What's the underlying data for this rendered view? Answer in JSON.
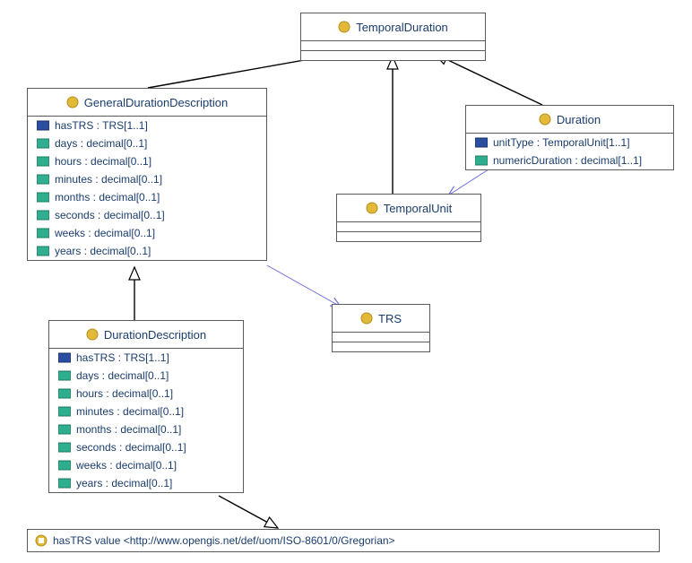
{
  "classes": {
    "temporalDuration": {
      "name": "TemporalDuration"
    },
    "generalDurationDescription": {
      "name": "GeneralDurationDescription",
      "attrs": {
        "hasTRS": {
          "label": "hasTRS : TRS[1..1]",
          "kind": "ref"
        },
        "days": {
          "label": "days : decimal[0..1]",
          "kind": "data"
        },
        "hours": {
          "label": "hours : decimal[0..1]",
          "kind": "data"
        },
        "minutes": {
          "label": "minutes : decimal[0..1]",
          "kind": "data"
        },
        "months": {
          "label": "months : decimal[0..1]",
          "kind": "data"
        },
        "seconds": {
          "label": "seconds : decimal[0..1]",
          "kind": "data"
        },
        "weeks": {
          "label": "weeks : decimal[0..1]",
          "kind": "data"
        },
        "years": {
          "label": "years : decimal[0..1]",
          "kind": "data"
        }
      }
    },
    "durationDescription": {
      "name": "DurationDescription",
      "attrs": {
        "hasTRS": {
          "label": "hasTRS : TRS[1..1]",
          "kind": "ref"
        },
        "days": {
          "label": "days : decimal[0..1]",
          "kind": "data"
        },
        "hours": {
          "label": "hours : decimal[0..1]",
          "kind": "data"
        },
        "minutes": {
          "label": "minutes : decimal[0..1]",
          "kind": "data"
        },
        "months": {
          "label": "months : decimal[0..1]",
          "kind": "data"
        },
        "seconds": {
          "label": "seconds : decimal[0..1]",
          "kind": "data"
        },
        "weeks": {
          "label": "weeks : decimal[0..1]",
          "kind": "data"
        },
        "years": {
          "label": "years : decimal[0..1]",
          "kind": "data"
        }
      }
    },
    "duration": {
      "name": "Duration",
      "attrs": {
        "unitType": {
          "label": "unitType : TemporalUnit[1..1]",
          "kind": "ref"
        },
        "numericDuration": {
          "label": "numericDuration : decimal[1..1]",
          "kind": "data"
        }
      }
    },
    "temporalUnit": {
      "name": "TemporalUnit"
    },
    "trs": {
      "name": "TRS"
    }
  },
  "restriction": {
    "label": "hasTRS value  <http://www.opengis.net/def/uom/ISO-8601/0/Gregorian>"
  }
}
